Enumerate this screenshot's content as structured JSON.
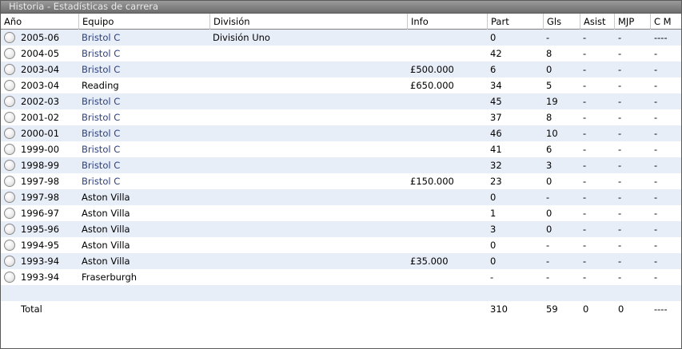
{
  "window": {
    "title": "Historia - Estadísticas de carrera"
  },
  "columns": [
    "Año",
    "Equipo",
    "División",
    "Info",
    "Part",
    "Gls",
    "Asist",
    "MJP",
    "C M"
  ],
  "rows": [
    {
      "year": "2005-06",
      "team": "Bristol C",
      "link": true,
      "division": "División Uno",
      "info": "",
      "part": "0",
      "gls": "-",
      "asist": "-",
      "mjp": "-",
      "cm": "----"
    },
    {
      "year": "2004-05",
      "team": "Bristol C",
      "link": true,
      "division": "",
      "info": "",
      "part": "42",
      "gls": "8",
      "asist": "-",
      "mjp": "-",
      "cm": "-"
    },
    {
      "year": "2003-04",
      "team": "Bristol C",
      "link": true,
      "division": "",
      "info": "£500.000",
      "part": "6",
      "gls": "0",
      "asist": "-",
      "mjp": "-",
      "cm": "-"
    },
    {
      "year": "2003-04",
      "team": "Reading",
      "link": false,
      "division": "",
      "info": "£650.000",
      "part": "34",
      "gls": "5",
      "asist": "-",
      "mjp": "-",
      "cm": "-"
    },
    {
      "year": "2002-03",
      "team": "Bristol C",
      "link": true,
      "division": "",
      "info": "",
      "part": "45",
      "gls": "19",
      "asist": "-",
      "mjp": "-",
      "cm": "-"
    },
    {
      "year": "2001-02",
      "team": "Bristol C",
      "link": true,
      "division": "",
      "info": "",
      "part": "37",
      "gls": "8",
      "asist": "-",
      "mjp": "-",
      "cm": "-"
    },
    {
      "year": "2000-01",
      "team": "Bristol C",
      "link": true,
      "division": "",
      "info": "",
      "part": "46",
      "gls": "10",
      "asist": "-",
      "mjp": "-",
      "cm": "-"
    },
    {
      "year": "1999-00",
      "team": "Bristol C",
      "link": true,
      "division": "",
      "info": "",
      "part": "41",
      "gls": "6",
      "asist": "-",
      "mjp": "-",
      "cm": "-"
    },
    {
      "year": "1998-99",
      "team": "Bristol C",
      "link": true,
      "division": "",
      "info": "",
      "part": "32",
      "gls": "3",
      "asist": "-",
      "mjp": "-",
      "cm": "-"
    },
    {
      "year": "1997-98",
      "team": "Bristol C",
      "link": true,
      "division": "",
      "info": "£150.000",
      "part": "23",
      "gls": "0",
      "asist": "-",
      "mjp": "-",
      "cm": "-"
    },
    {
      "year": "1997-98",
      "team": "Aston Villa",
      "link": false,
      "division": "",
      "info": "",
      "part": "0",
      "gls": "-",
      "asist": "-",
      "mjp": "-",
      "cm": "-"
    },
    {
      "year": "1996-97",
      "team": "Aston Villa",
      "link": false,
      "division": "",
      "info": "",
      "part": "1",
      "gls": "0",
      "asist": "-",
      "mjp": "-",
      "cm": "-"
    },
    {
      "year": "1995-96",
      "team": "Aston Villa",
      "link": false,
      "division": "",
      "info": "",
      "part": "3",
      "gls": "0",
      "asist": "-",
      "mjp": "-",
      "cm": "-"
    },
    {
      "year": "1994-95",
      "team": "Aston Villa",
      "link": false,
      "division": "",
      "info": "",
      "part": "0",
      "gls": "-",
      "asist": "-",
      "mjp": "-",
      "cm": "-"
    },
    {
      "year": "1993-94",
      "team": "Aston Villa",
      "link": false,
      "division": "",
      "info": "£35.000",
      "part": "0",
      "gls": "-",
      "asist": "-",
      "mjp": "-",
      "cm": "-"
    },
    {
      "year": "1993-94",
      "team": "Fraserburgh",
      "link": false,
      "division": "",
      "info": "",
      "part": "-",
      "gls": "-",
      "asist": "-",
      "mjp": "-",
      "cm": "-"
    }
  ],
  "total": {
    "label": "Total",
    "part": "310",
    "gls": "59",
    "asist": "0",
    "mjp": "0",
    "cm": "----"
  },
  "colors": {
    "link": "#2b3f80",
    "row_alt": "#e8eef8",
    "title_bg": "#7e7e7e"
  }
}
